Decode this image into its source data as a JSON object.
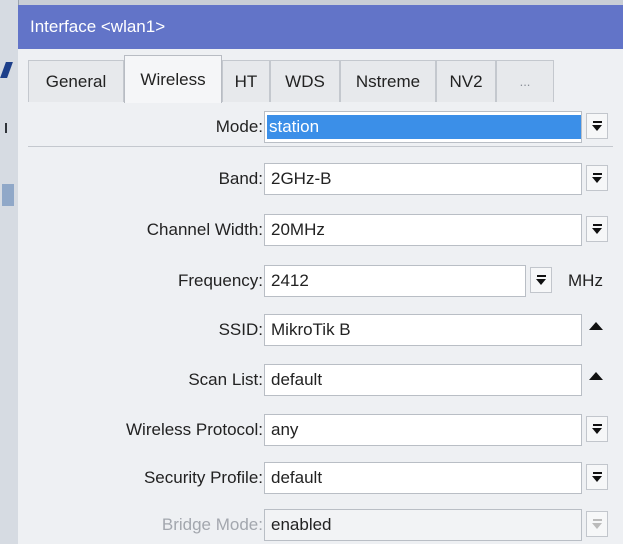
{
  "window": {
    "title": "Interface <wlan1>"
  },
  "tabs": [
    {
      "label": "General",
      "active": false
    },
    {
      "label": "Wireless",
      "active": true
    },
    {
      "label": "HT",
      "active": false
    },
    {
      "label": "WDS",
      "active": false
    },
    {
      "label": "Nstreme",
      "active": false
    },
    {
      "label": "NV2",
      "active": false
    },
    {
      "label": "...",
      "active": false
    }
  ],
  "form": {
    "mode": {
      "label": "Mode:",
      "value": "station"
    },
    "band": {
      "label": "Band:",
      "value": "2GHz-B"
    },
    "channel_width": {
      "label": "Channel Width:",
      "value": "20MHz"
    },
    "frequency": {
      "label": "Frequency:",
      "value": "2412",
      "unit": "MHz"
    },
    "ssid": {
      "label": "SSID:",
      "value": "MikroTik B"
    },
    "scan_list": {
      "label": "Scan List:",
      "value": "default"
    },
    "wireless_protocol": {
      "label": "Wireless Protocol:",
      "value": "any"
    },
    "security_profile": {
      "label": "Security Profile:",
      "value": "default"
    },
    "bridge_mode": {
      "label": "Bridge Mode:",
      "value": "enabled",
      "disabled": true
    }
  },
  "colors": {
    "titlebar": "#6274c8",
    "selection": "#3b8fe8"
  }
}
